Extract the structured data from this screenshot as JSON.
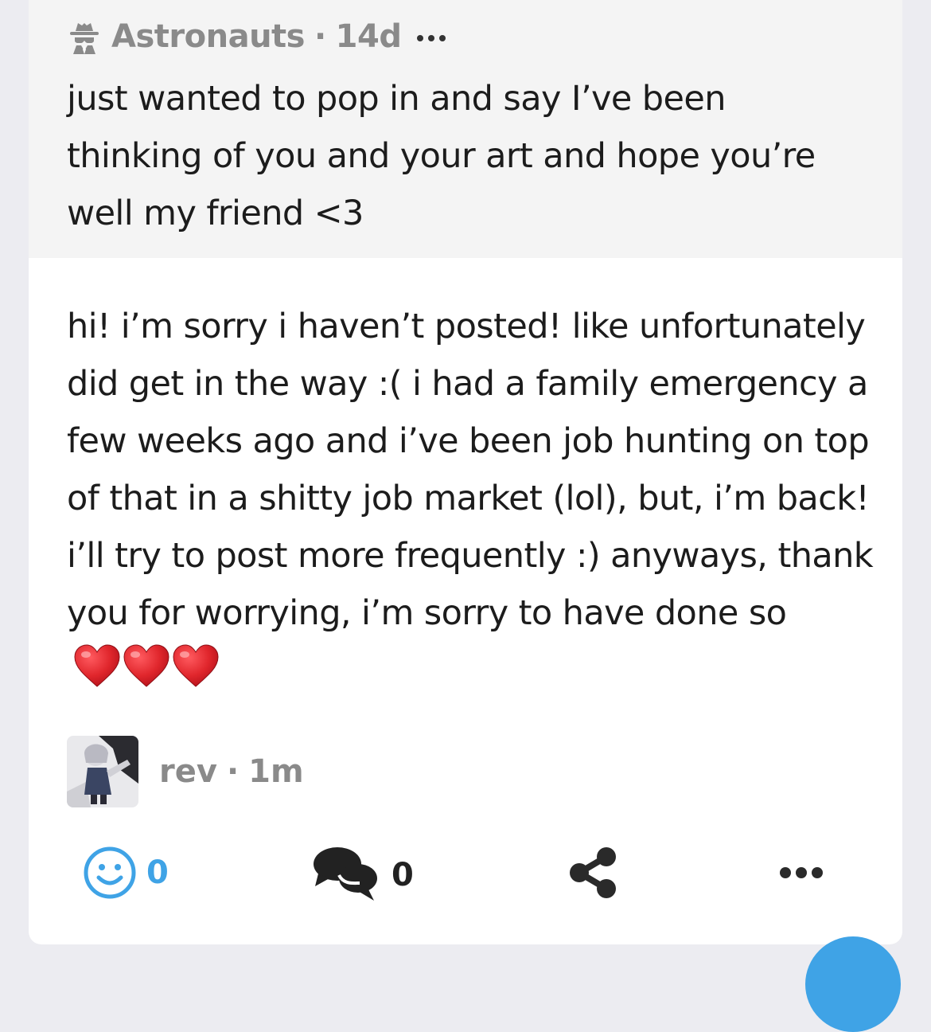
{
  "ask": {
    "asker": "Astronauts",
    "separator": "·",
    "time": "14d",
    "icon": "anonymous-spy-icon",
    "text": "just wanted to pop in and say I’ve been thinking of you and your art and hope you’re well my friend <3"
  },
  "answer": {
    "text": "hi! i’m sorry i haven’t posted! like unfortunately did get in the way :( i had a family emergency a few weeks ago and i’ve been job hunting on top of that in a shitty job market (lol), but, i’m back! i’ll try to post more frequently :) anyways, thank you for worrying, i’m sorry to have done so",
    "emoji": "❤️❤️❤️",
    "author": "rev",
    "separator": "·",
    "time": "1m"
  },
  "actions": {
    "reactions_count": "0",
    "comments_count": "0",
    "share_icon": "share-icon",
    "more_icon": "more-options-icon"
  },
  "colors": {
    "accent": "#3fa3e6",
    "muted_text": "#8a8a8a",
    "heart": "#e0262c",
    "ask_background": "#f4f4f4"
  }
}
